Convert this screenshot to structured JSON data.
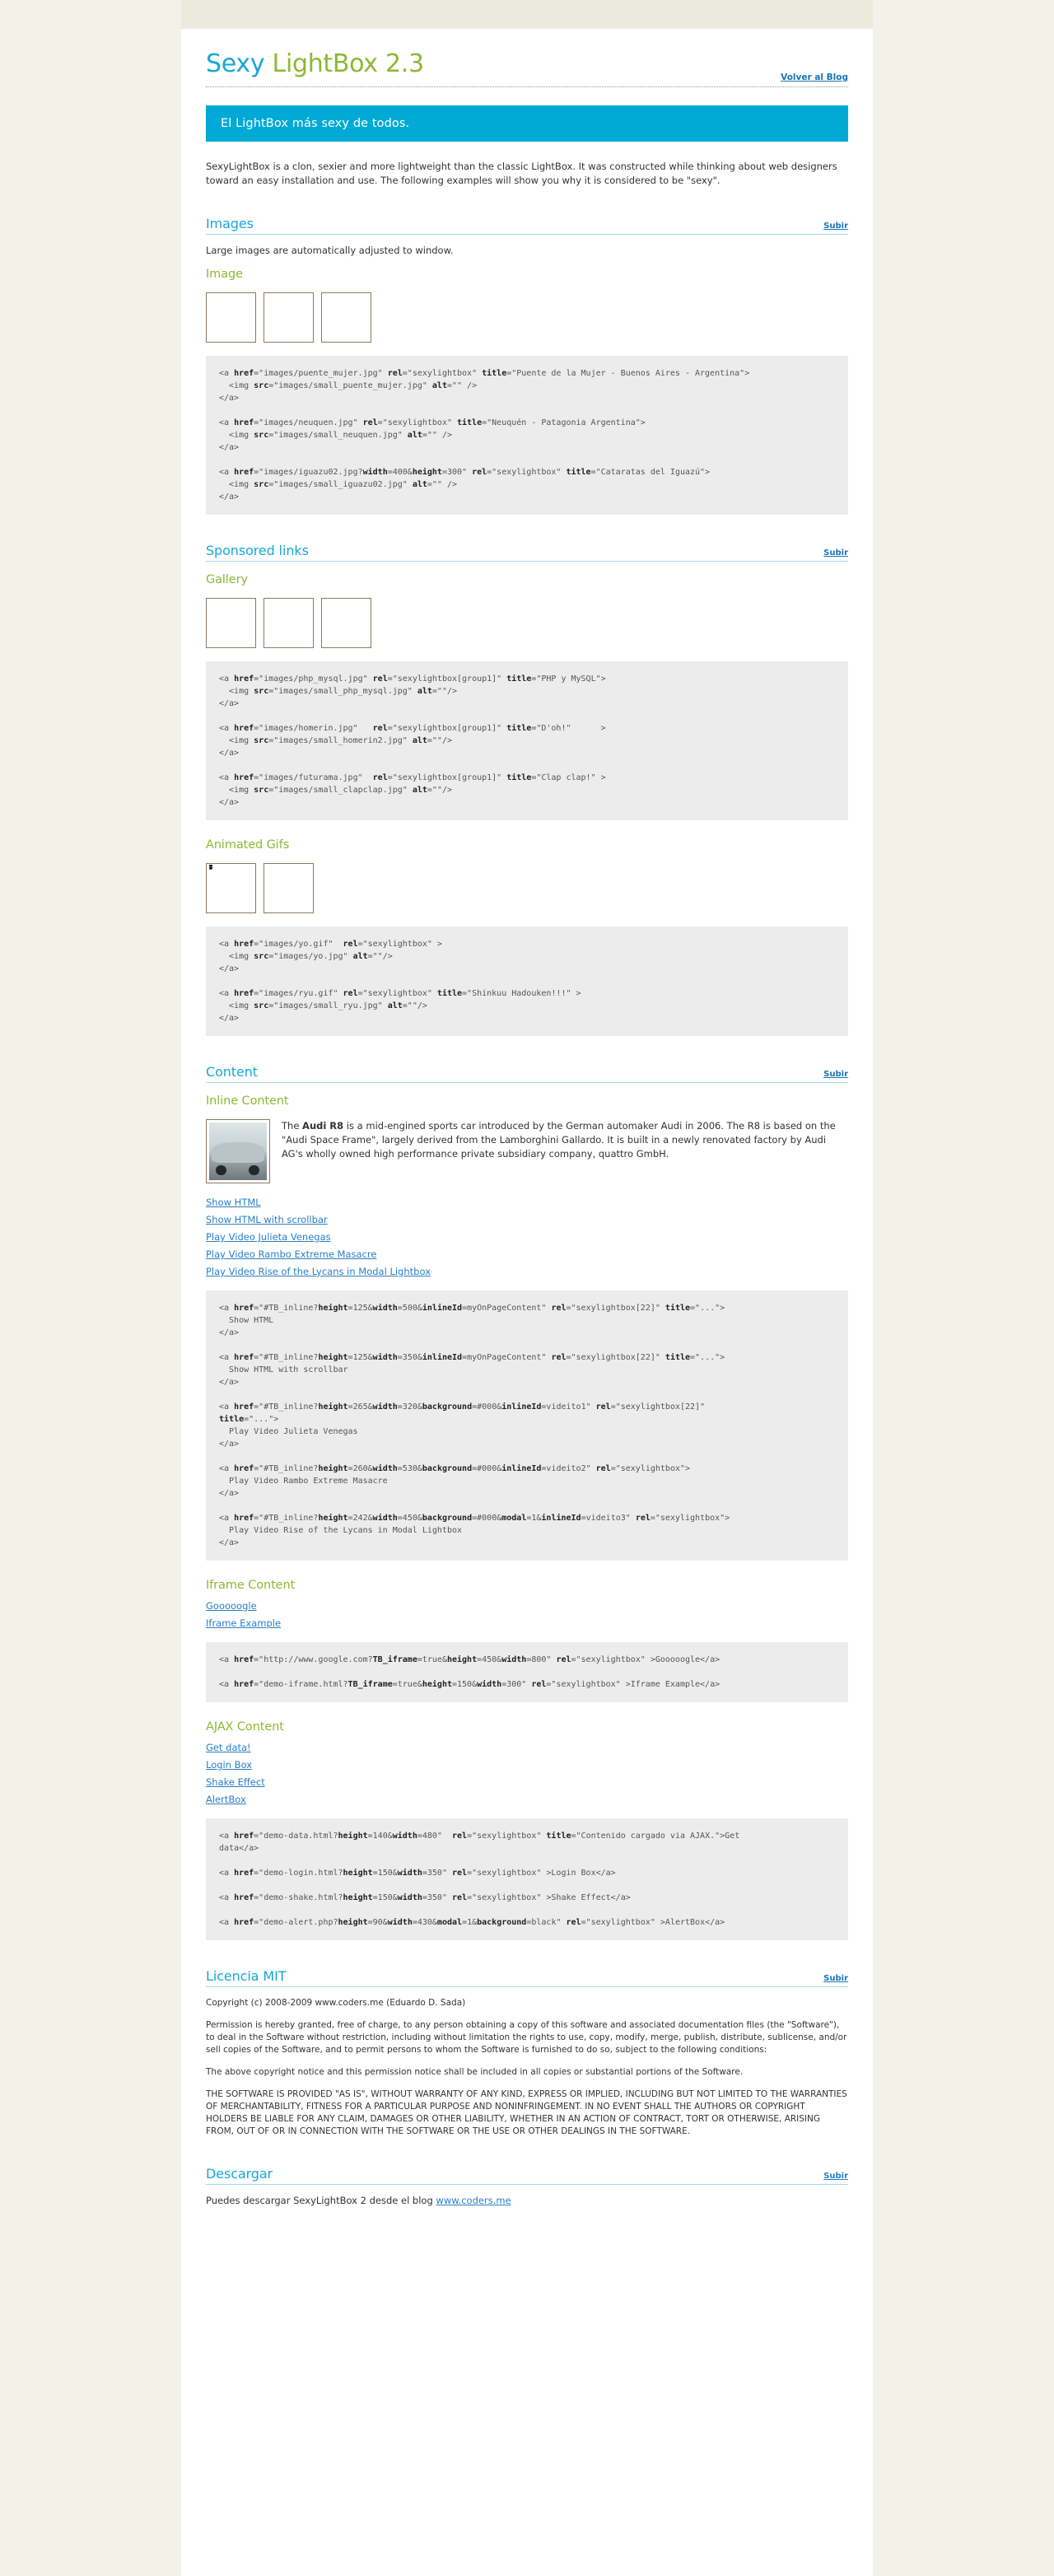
{
  "header": {
    "title_part1": "Sexy",
    "title_part2": "LightBox 2.3",
    "back_link": "Volver al Blog",
    "banner": "El LightBox más sexy de todos.",
    "intro": "SexyLightBox is a clon, sexier and more lightweight than the classic LightBox. It was constructed while thinking about web designers toward an easy installation and use. The following examples will show you why it is considered to be \"sexy\"."
  },
  "common": {
    "subir": "Subir"
  },
  "sections": {
    "images": {
      "heading": "Images",
      "note": "Large images are automatically adjusted to window.",
      "subheading": "Image",
      "thumbs": [
        {
          "name": "puente-mujer-thumb"
        },
        {
          "name": "neuquen-thumb"
        },
        {
          "name": "iguazu-thumb"
        }
      ],
      "code": "<a href=\"images/puente_mujer.jpg\" rel=\"sexylightbox\" title=\"Puente de la Mujer - Buenos Aires - Argentina\">\n  <img src=\"images/small_puente_mujer.jpg\" alt=\"\" />\n</a>\n\n<a href=\"images/neuquen.jpg\" rel=\"sexylightbox\" title=\"Neuquén - Patagonia Argentina\">\n  <img src=\"images/small_neuquen.jpg\" alt=\"\" />\n</a>\n\n<a href=\"images/iguazu02.jpg?width=400&height=300\" rel=\"sexylightbox\" title=\"Cataratas del Iguazú\">\n  <img src=\"images/small_iguazu02.jpg\" alt=\"\" />\n</a>"
    },
    "sponsored": {
      "heading": "Sponsored links",
      "subheading": "Gallery",
      "code": "<a href=\"images/php_mysql.jpg\" rel=\"sexylightbox[group1]\" title=\"PHP y MySQL\">\n  <img src=\"images/small_php_mysql.jpg\" alt=\"\"/>\n</a>\n\n<a href=\"images/homerin.jpg\"   rel=\"sexylightbox[group1]\" title=\"D'oh!\"      >\n  <img src=\"images/small_homerin2.jpg\" alt=\"\"/>\n</a>\n\n<a href=\"images/futurama.jpg\"  rel=\"sexylightbox[group1]\" title=\"Clap clap!\" >\n  <img src=\"images/small_clapclap.jpg\" alt=\"\"/>\n</a>",
      "gifs_subheading": "Animated Gifs",
      "gifs_code": "<a href=\"images/yo.gif\"  rel=\"sexylightbox\" >\n  <img src=\"images/yo.jpg\" alt=\"\"/>\n</a>\n\n<a href=\"images/ryu.gif\" rel=\"sexylightbox\" title=\"Shinkuu Hadouken!!!\" >\n  <img src=\"images/small_ryu.jpg\" alt=\"\"/>\n</a>"
    },
    "content": {
      "heading": "Content",
      "subheading": "Inline Content",
      "paragraph_pre": "The ",
      "paragraph_bold": "Audi R8",
      "paragraph_rest": " is a mid-engined sports car introduced by the German automaker Audi in 2006. The R8 is based on the \"Audi Space Frame\", largely derived from the Lamborghini Gallardo. It is built in a newly renovated factory by Audi AG's wholly owned high performance private subsidiary company, quattro GmbH.",
      "links": [
        "Show HTML",
        "Show HTML with scrollbar",
        "Play Video Julieta Venegas",
        "Play Video Rambo Extreme Masacre",
        "Play Video Rise of the Lycans in Modal Lightbox"
      ],
      "code": "<a href=\"#TB_inline?height=125&width=500&inlineId=myOnPageContent\" rel=\"sexylightbox[22]\" title=\"...\">\n  Show HTML\n</a>\n\n<a href=\"#TB_inline?height=125&width=350&inlineId=myOnPageContent\" rel=\"sexylightbox[22]\" title=\"...\">\n  Show HTML with scrollbar\n</a>\n\n<a href=\"#TB_inline?height=265&width=320&background=#000&inlineId=videito1\" rel=\"sexylightbox[22]\"\ntitle=\"...\">\n  Play Video Julieta Venegas\n</a>\n\n<a href=\"#TB_inline?height=260&width=530&background=#000&inlineId=videito2\" rel=\"sexylightbox\">\n  Play Video Rambo Extreme Masacre\n</a>\n\n<a href=\"#TB_inline?height=242&width=450&background=#000&modal=1&inlineId=videito3\" rel=\"sexylightbox\">\n  Play Video Rise of the Lycans in Modal Lightbox\n</a>"
    },
    "iframe": {
      "subheading": "Iframe Content",
      "links": [
        "Gooooogle",
        "Iframe Example"
      ],
      "code": "<a href=\"http://www.google.com?TB_iframe=true&height=450&width=800\" rel=\"sexylightbox\" >Gooooogle</a>\n\n<a href=\"demo-iframe.html?TB_iframe=true&height=150&width=300\" rel=\"sexylightbox\" >Iframe Example</a>"
    },
    "ajax": {
      "subheading": "AJAX Content",
      "links": [
        "Get data!",
        "Login Box",
        "Shake Effect",
        "AlertBox"
      ],
      "code": "<a href=\"demo-data.html?height=140&width=480\"  rel=\"sexylightbox\" title=\"Contenido cargado via AJAX.\">Get\ndata</a>\n\n<a href=\"demo-login.html?height=150&width=350\" rel=\"sexylightbox\" >Login Box</a>\n\n<a href=\"demo-shake.html?height=150&width=350\" rel=\"sexylightbox\" >Shake Effect</a>\n\n<a href=\"demo-alert.php?height=90&width=430&modal=1&background=black\" rel=\"sexylightbox\" >AlertBox</a>"
    },
    "license": {
      "heading": "Licencia MIT",
      "copyright": "Copyright (c) 2008-2009 www.coders.me (Eduardo D. Sada)",
      "p1": "Permission is hereby granted, free of charge, to any person obtaining a copy of this software and associated documentation files (the \"Software\"), to deal in the Software without restriction, including without limitation the rights to use, copy, modify, merge, publish, distribute, sublicense, and/or sell copies of the Software, and to permit persons to whom the Software is furnished to do so, subject to the following conditions:",
      "p2": "The above copyright notice and this permission notice shall be included in all copies or substantial portions of the Software.",
      "p3": "THE SOFTWARE IS PROVIDED \"AS IS\", WITHOUT WARRANTY OF ANY KIND, EXPRESS OR IMPLIED, INCLUDING BUT NOT LIMITED TO THE WARRANTIES OF MERCHANTABILITY, FITNESS FOR A PARTICULAR PURPOSE AND NONINFRINGEMENT. IN NO EVENT SHALL THE AUTHORS OR COPYRIGHT HOLDERS BE LIABLE FOR ANY CLAIM, DAMAGES OR OTHER LIABILITY, WHETHER IN AN ACTION OF CONTRACT, TORT OR OTHERWISE, ARISING FROM, OUT OF OR IN CONNECTION WITH THE SOFTWARE OR THE USE OR OTHER DEALINGS IN THE SOFTWARE."
    },
    "download": {
      "heading": "Descargar",
      "text_pre": "Puedes descargar SexyLightBox 2 desde el blog ",
      "link": "www.coders.me"
    }
  },
  "colors": {
    "accent_blue": "#18a7d8",
    "accent_green": "#8eb833",
    "banner_bg": "#00a9d6",
    "link_blue": "#2a7fc4",
    "page_bg": "#f2f2e8"
  }
}
